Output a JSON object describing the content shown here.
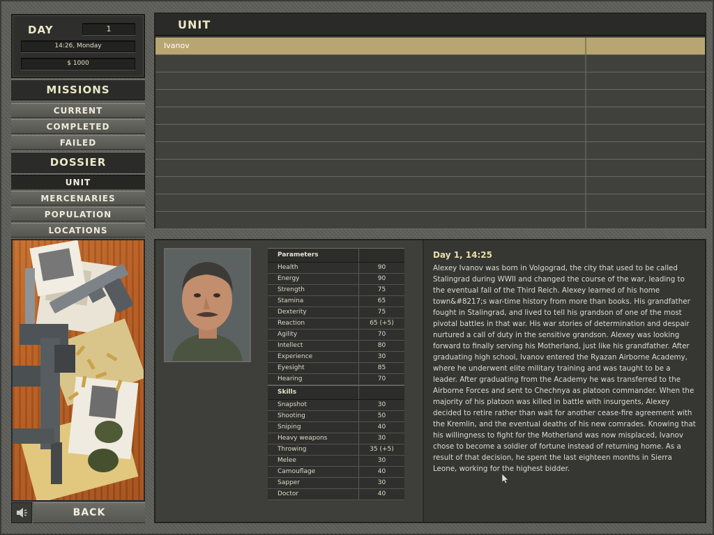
{
  "status": {
    "day_label": "DAY",
    "day_value": "1",
    "time": "14:26, Monday",
    "money": "$ 1000"
  },
  "missions": {
    "header": "MISSIONS",
    "items": [
      "CURRENT",
      "COMPLETED",
      "FAILED"
    ]
  },
  "dossier": {
    "header": "DOSSIER",
    "items": [
      "UNIT",
      "MERCENARIES",
      "POPULATION",
      "LOCATIONS"
    ],
    "active": "UNIT"
  },
  "back_label": "BACK",
  "unit": {
    "title": "UNIT",
    "rows": [
      "Ivanov",
      "",
      "",
      "",
      "",
      "",
      "",
      "",
      "",
      "",
      ""
    ]
  },
  "stats": {
    "parameters_header": "Parameters",
    "parameters": [
      {
        "name": "Health",
        "value": "90"
      },
      {
        "name": "Energy",
        "value": "90"
      },
      {
        "name": "Strength",
        "value": "75"
      },
      {
        "name": "Stamina",
        "value": "65"
      },
      {
        "name": "Dexterity",
        "value": "75"
      },
      {
        "name": "Reaction",
        "value": "65 (+5)"
      },
      {
        "name": "Agility",
        "value": "70"
      },
      {
        "name": "Intellect",
        "value": "80"
      },
      {
        "name": "Experience",
        "value": "30"
      },
      {
        "name": "Eyesight",
        "value": "85"
      },
      {
        "name": "Hearing",
        "value": "70"
      }
    ],
    "skills_header": "Skills",
    "skills": [
      {
        "name": "Snapshot",
        "value": "30"
      },
      {
        "name": "Shooting",
        "value": "50"
      },
      {
        "name": "Sniping",
        "value": "40"
      },
      {
        "name": "Heavy weapons",
        "value": "30"
      },
      {
        "name": "Throwing",
        "value": "35 (+5)"
      },
      {
        "name": "Melee",
        "value": "30"
      },
      {
        "name": "Camouflage",
        "value": "40"
      },
      {
        "name": "Sapper",
        "value": "30"
      },
      {
        "name": "Doctor",
        "value": "40"
      }
    ]
  },
  "bio": {
    "title": "Day 1, 14:25",
    "text": "Alexey Ivanov was born in Volgograd, the city that used to be called Stalingrad during WWII and changed the course of the war, leading to the eventual fall of the Third Reich. Alexey learned of his home town&#8217;s war-time history from more than books. His grandfather fought in Stalingrad, and lived to tell his grandson of one of the most pivotal battles in that war. His war stories of determination and despair nurtured a call of duty in the sensitive grandson. Alexey was looking forward to finally serving his Motherland, just like his grandfather. After graduating high school, Ivanov entered the Ryazan Airborne Academy, where he underwent elite military training and was taught to be a leader. After graduating from the Academy he was transferred to the Airborne Forces and sent to Chechnya as platoon commander. When the majority of his platoon was killed in battle with insurgents, Alexey decided to retire rather than wait for another cease-fire agreement with the Kremlin, and the eventual deaths of his new comrades. Knowing that his willingness to fight for the Motherland was now misplaced, Ivanov chose to become a soldier of fortune instead of returning home. As a result of that decision, he spent the last eighteen months in Sierra Leone, working for the highest bidder."
  }
}
